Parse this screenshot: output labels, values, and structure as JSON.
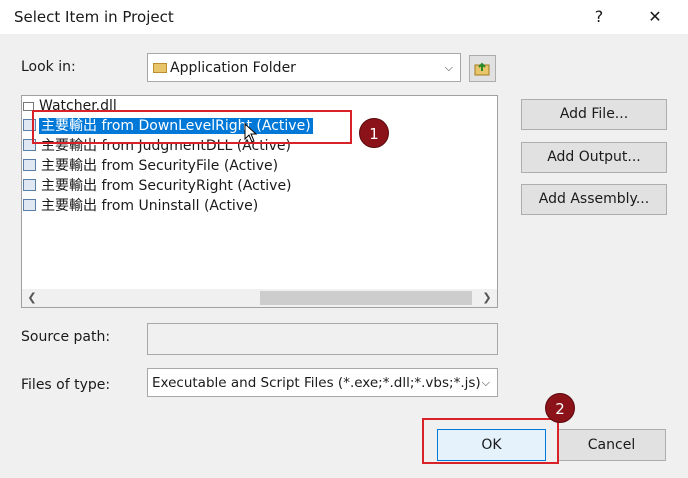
{
  "window": {
    "title": "Select Item in Project",
    "help_label": "?",
    "close_label": "✕"
  },
  "look_in": {
    "label": "Look in:",
    "value": "Application Folder"
  },
  "list_items": [
    "Watcher.dll",
    "主要輸出 from DownLevelRight (Active)",
    "主要輸出 from JudgmentDLL (Active)",
    "主要輸出 from SecurityFile (Active)",
    "主要輸出 from SecurityRight (Active)",
    "主要輸出 from Uninstall (Active)"
  ],
  "selected_index": 1,
  "side_buttons": {
    "add_file": "Add File...",
    "add_output": "Add Output...",
    "add_assembly": "Add Assembly..."
  },
  "source_path": {
    "label": "Source path:",
    "value": ""
  },
  "files_of_type": {
    "label": "Files of type:",
    "value": "Executable and Script Files (*.exe;*.dll;*.vbs;*.js)"
  },
  "footer": {
    "ok_label": "OK",
    "cancel_label": "Cancel"
  },
  "annotations": [
    {
      "number": "1"
    },
    {
      "number": "2"
    }
  ],
  "colors": {
    "highlight": "#0078d7",
    "annotation_red": "#d92228",
    "badge": "#8b1218"
  }
}
